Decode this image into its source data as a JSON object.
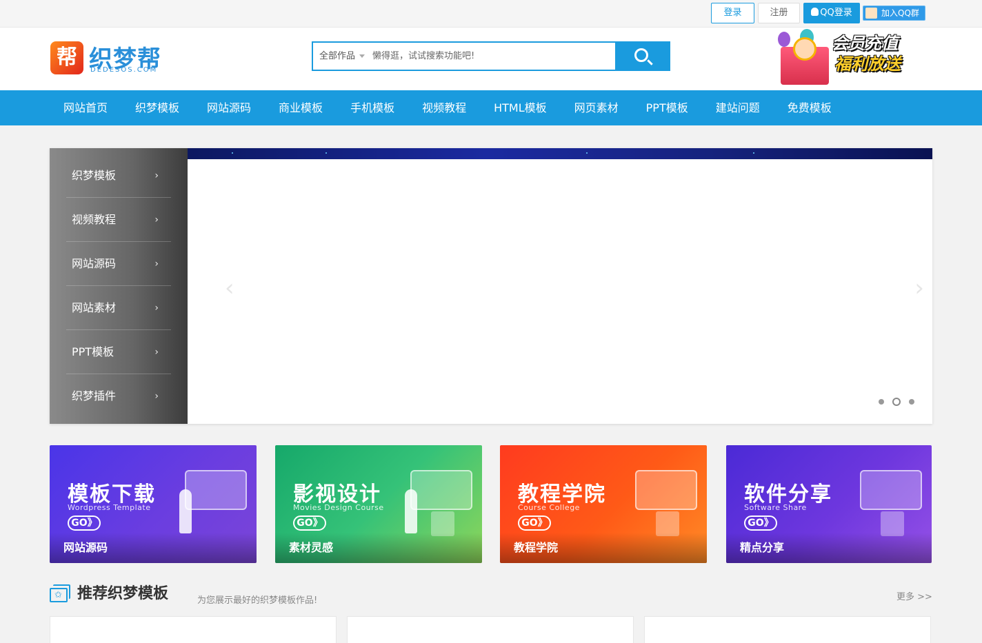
{
  "topbar": {
    "login": "登录",
    "register": "注册",
    "qq_login": "QQ登录",
    "join_qq_group": "加入QQ群"
  },
  "logo": {
    "mark": "帮",
    "name": "织梦帮",
    "domain": "DEDESOS.COM"
  },
  "search": {
    "category": "全部作品",
    "placeholder": "懒得逛，试试搜索功能吧!"
  },
  "promo": {
    "line1": "会员充值",
    "line2": "福利放送"
  },
  "nav": {
    "items": [
      {
        "label": "网站首页"
      },
      {
        "label": "织梦模板"
      },
      {
        "label": "网站源码"
      },
      {
        "label": "商业模板"
      },
      {
        "label": "手机模板"
      },
      {
        "label": "视频教程"
      },
      {
        "label": "HTML模板"
      },
      {
        "label": "网页素材"
      },
      {
        "label": "PPT模板"
      },
      {
        "label": "建站问题"
      },
      {
        "label": "免费模板"
      }
    ]
  },
  "banner": {
    "sidebar": [
      {
        "label": "织梦模板"
      },
      {
        "label": "视频教程"
      },
      {
        "label": "网站源码"
      },
      {
        "label": "网站素材"
      },
      {
        "label": "PPT模板"
      },
      {
        "label": "织梦插件"
      }
    ],
    "prev": "‹",
    "next": "›",
    "slide_count": 3,
    "active_slide": 2
  },
  "cards": [
    {
      "title": "模板下载",
      "en": "Wordpress Template",
      "go": "GO》",
      "label": "网站源码"
    },
    {
      "title": "影视设计",
      "en": "Movies Design Course",
      "go": "GO》",
      "label": "素材灵感"
    },
    {
      "title": "教程学院",
      "en": "Course College",
      "go": "GO》",
      "label": "教程学院"
    },
    {
      "title": "软件分享",
      "en": "Software Share",
      "go": "GO》",
      "label": "精点分享"
    }
  ],
  "section": {
    "title": "推荐织梦模板",
    "subtitle": "为您展示最好的织梦模板作品!",
    "more": "更多 >>"
  },
  "colors": {
    "brand_blue": "#1a9bde",
    "promo_yellow": "#ffcf2b"
  }
}
